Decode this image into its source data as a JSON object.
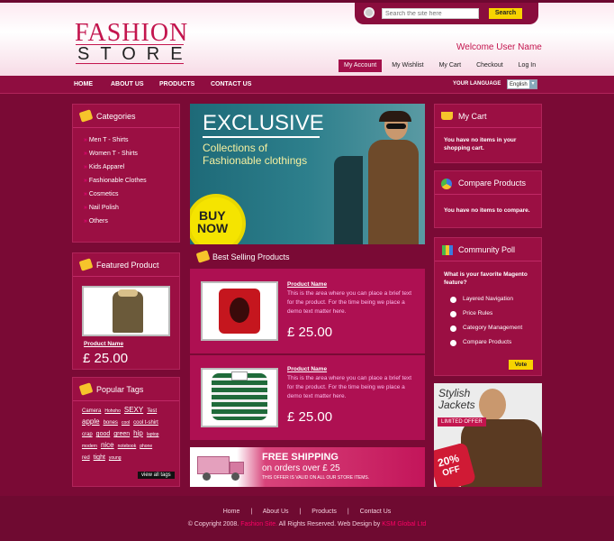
{
  "logo": {
    "line1": "FASHION",
    "line2": "STORE"
  },
  "search": {
    "placeholder": "Search the site here",
    "button": "Search"
  },
  "welcome": "Welcome User Name",
  "toplinks": [
    "My Account",
    "My Wishlist",
    "My Cart",
    "Checkout",
    "Log In"
  ],
  "nav": [
    "HOME",
    "ABOUT US",
    "PRODUCTS",
    "CONTACT US"
  ],
  "language": {
    "label": "YOUR LANGUAGE",
    "value": "English"
  },
  "categories": {
    "title": "Categories",
    "items": [
      "Men T - Shirts",
      "Women T - Shirts",
      "Kids Apparel",
      "Fashionable Clothes",
      "Cosmetics",
      "Nail Polish",
      "Others"
    ]
  },
  "featured": {
    "title": "Featured Product",
    "name": "Product Name",
    "price": "£ 25.00"
  },
  "tags": {
    "title": "Popular Tags",
    "items": [
      "Camera",
      "Hohoho",
      "SEXY",
      "Test",
      "apple",
      "bones",
      "cool",
      "cool t-shirt",
      "crap",
      "good",
      "green",
      "hip",
      "laptop",
      "modern",
      "nice",
      "notebook",
      "phone",
      "red",
      "tight",
      "young"
    ],
    "button": "view all tags"
  },
  "banner": {
    "heading": "EXCLUSIVE",
    "sub1": "Collections of",
    "sub2": "Fashionable clothings",
    "burst1": "BUY",
    "burst2": "NOW"
  },
  "bestselling": {
    "title": "Best Selling Products",
    "products": [
      {
        "name": "Product Name",
        "desc": "This is the area where you can place a brief text for the product. For the time being we place a demo text matter here.",
        "price": "£ 25.00"
      },
      {
        "name": "Product Name",
        "desc": "This is the area where you can place a brief text for the product. For the time being we place a demo text matter here.",
        "price": "£ 25.00"
      }
    ]
  },
  "shipping": {
    "l1": "FREE SHIPPING",
    "l2": "on orders over £ 25",
    "l3": "THIS OFFER IS VALID ON ALL OUR STORE ITEMS."
  },
  "cart": {
    "title": "My Cart",
    "text": "You have no items in your shopping cart."
  },
  "compare": {
    "title": "Compare Products",
    "text": "You have no items to compare."
  },
  "poll": {
    "title": "Community Poll",
    "question": "What is your favorite Magento feature?",
    "options": [
      "Layered Navigation",
      "Price Rules",
      "Category Management",
      "Compare Products"
    ],
    "vote": "Vote"
  },
  "promo": {
    "l1": "Stylish",
    "l2": "Jackets",
    "l3": "LIMITED OFFER",
    "l4": "20%",
    "l5": "OFF"
  },
  "footer": {
    "links": [
      "Home",
      "About Us",
      "Products",
      "Contact Us"
    ],
    "sep": "|",
    "copy1": "© Copyright 2008.",
    "site": "Fashion Site.",
    "copy2": "All Rights Reserved. Web Design by",
    "company": "KSM Global Ltd"
  }
}
